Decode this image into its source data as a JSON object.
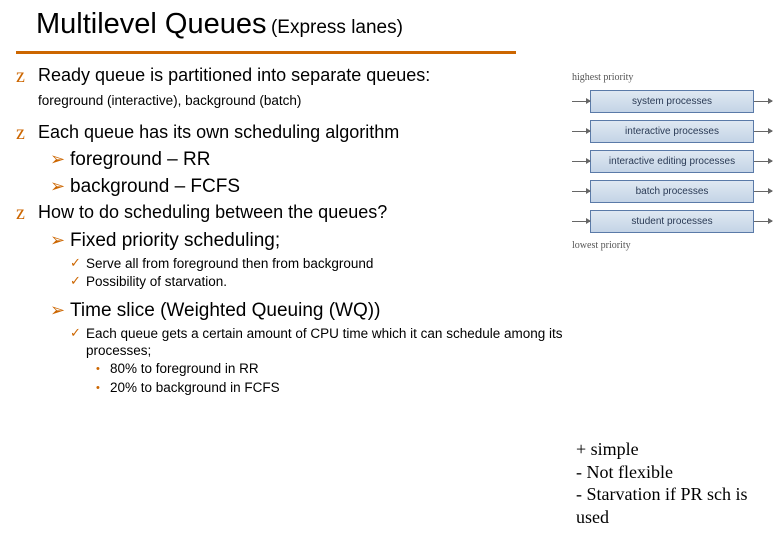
{
  "title": "Multilevel Queues",
  "subtitle": "(Express lanes)",
  "bullets": {
    "b1": "Ready queue is partitioned into separate queues:",
    "b1_sub": "foreground (interactive), background (batch)",
    "b2": "Each queue has its own scheduling algorithm",
    "b2_a1": "foreground – RR",
    "b2_a2": "background – FCFS",
    "b3": "How to do scheduling between the queues?",
    "b3_a1": "Fixed priority scheduling;",
    "b3_a1_c1": "Serve all from foreground then from background",
    "b3_a1_c2": "Possibility of starvation.",
    "b3_a2": "Time slice (Weighted Queuing (WQ))",
    "b3_a2_c1": "Each queue gets a certain amount of CPU time which it can schedule among its processes;",
    "b3_a2_d1": "80% to foreground in RR",
    "b3_a2_d2": "20% to background in FCFS"
  },
  "diagram": {
    "top_label": "highest priority",
    "bottom_label": "lowest priority",
    "queues": [
      "system processes",
      "interactive processes",
      "interactive editing processes",
      "batch processes",
      "student processes"
    ]
  },
  "notes": {
    "n1": "+ simple",
    "n2": "-   Not flexible",
    "n3": "-   Starvation if PR sch is used"
  },
  "glyphs": {
    "z": "z",
    "arrow": "➢",
    "check": "✓",
    "dot": "•"
  }
}
